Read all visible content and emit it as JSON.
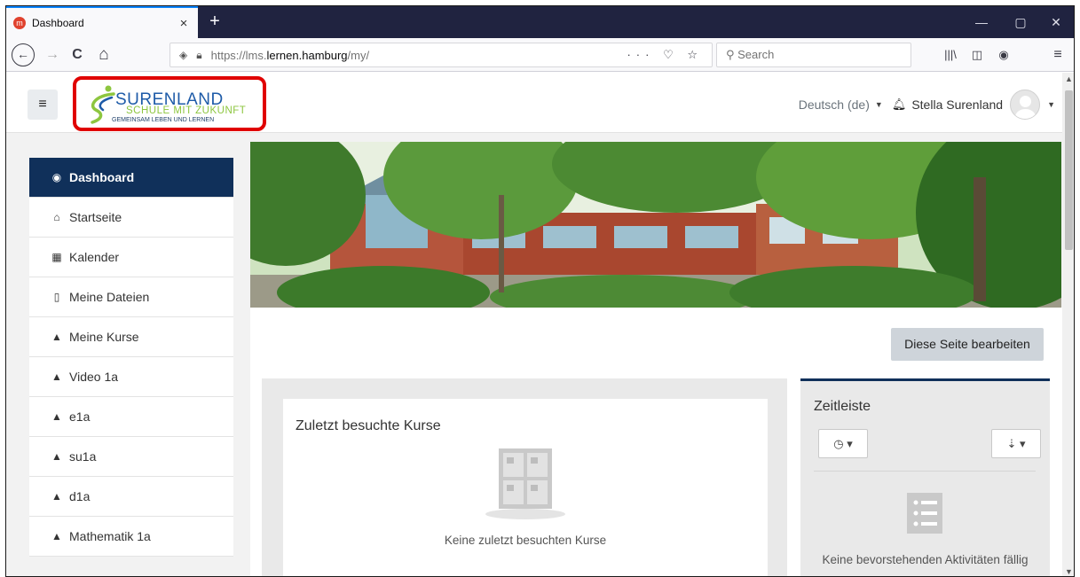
{
  "browser": {
    "tab_title": "Dashboard",
    "tab_favicon": "moodle-favicon",
    "tab_close": "×",
    "new_tab": "+",
    "window_controls": {
      "minimize": "—",
      "restore": "▢",
      "close": "✕"
    },
    "nav": {
      "back": "←",
      "forward": "→",
      "reload": "C",
      "home": "⌂"
    },
    "url": {
      "prefix": "https://lms.",
      "domain": "lernen.hamburg",
      "path": "/my/"
    },
    "url_actions": "··· ♡ ☆",
    "search_placeholder": "Search",
    "toolbar_icons": [
      "library-icon",
      "sidebar-icon",
      "account-icon",
      "menu-icon"
    ]
  },
  "header": {
    "menu_icon": "≡",
    "logo": {
      "name": "SURENLAND",
      "tagline": "SCHULE MIT ZUKUNFT",
      "subline": "GEMEINSAM LEBEN UND LERNEN"
    },
    "language": "Deutsch (de)",
    "user_name": "Stella Surenland"
  },
  "sidebar": {
    "items": [
      {
        "label": "Dashboard",
        "icon": "dashboard-icon",
        "glyph": "◉",
        "active": true
      },
      {
        "label": "Startseite",
        "icon": "home-icon",
        "glyph": "⌂"
      },
      {
        "label": "Kalender",
        "icon": "calendar-icon",
        "glyph": "▦"
      },
      {
        "label": "Meine Dateien",
        "icon": "file-icon",
        "glyph": "▯"
      },
      {
        "label": "Meine Kurse",
        "icon": "graduation-cap-icon",
        "glyph": "▲"
      },
      {
        "label": "Video 1a",
        "icon": "graduation-cap-icon",
        "glyph": "▲"
      },
      {
        "label": "e1a",
        "icon": "graduation-cap-icon",
        "glyph": "▲"
      },
      {
        "label": "su1a",
        "icon": "graduation-cap-icon",
        "glyph": "▲"
      },
      {
        "label": "d1a",
        "icon": "graduation-cap-icon",
        "glyph": "▲"
      },
      {
        "label": "Mathematik 1a",
        "icon": "graduation-cap-icon",
        "glyph": "▲"
      }
    ]
  },
  "main": {
    "edit_button": "Diese Seite bearbeiten",
    "recent": {
      "title": "Zuletzt besuchte Kurse",
      "empty": "Keine zuletzt besuchten Kurse"
    },
    "timeline": {
      "title": "Zeitleiste",
      "filter_icon": "◷ ▾",
      "sort_icon": "⇣ ▾",
      "empty": "Keine bevorstehenden Aktivitäten fällig"
    }
  },
  "colors": {
    "brand_navy": "#10305a",
    "highlight_red": "#e00000",
    "logo_blue": "#1e5ba8",
    "logo_green": "#8dc63f"
  }
}
